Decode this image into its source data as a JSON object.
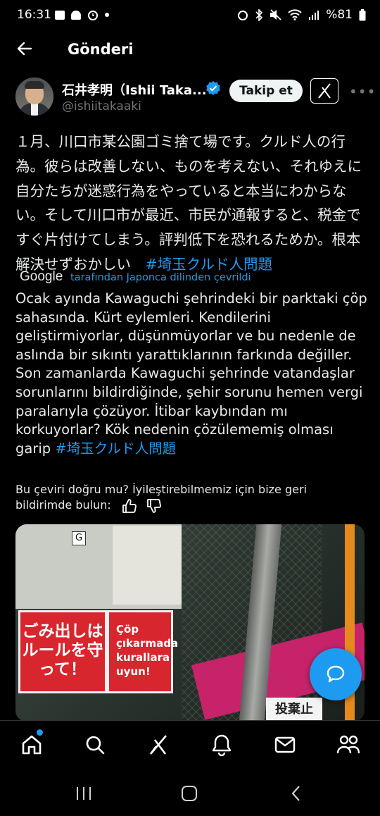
{
  "status_bar": {
    "time": "16:31",
    "battery": "%81",
    "icons": [
      "gallery-icon",
      "messages-icon",
      "alarm-icon",
      "dot-icon",
      "alarm-icon",
      "bluetooth-icon",
      "mute-icon",
      "wifi-icon",
      "signal-icon",
      "battery-icon"
    ]
  },
  "header": {
    "title": "Gönderi",
    "back_icon": "arrow-left-icon"
  },
  "post": {
    "author_name": "石井孝明（Ishii Taka...",
    "author_handle": "@ishiitakaaki",
    "verified_icon": "verified-badge-icon",
    "follow_label": "Takip et",
    "grok_icon": "grok-icon",
    "more_icon": "more-horizontal-icon",
    "original_text": "１月、川口市某公園ゴミ捨て場です。クルド人の行為。彼らは改善しない、ものを考えない、それゆえに自分たちが迷惑行為をやっていると本当にわからない。そして川口市が最近、市民が通報すると、税金ですぐ片付けてしまう。評判低下を恐れるためか。根本解決せずおかしい　",
    "original_hashtag": "#埼玉クルド人問題",
    "translation_provider": "Google",
    "translation_via": "tarafından Japonca dilinden çevrildi",
    "translated_text": "Ocak ayında Kawaguchi şehrindeki bir parktaki çöp sahasında. Kürt eylemleri. Kendilerini geliştirmiyorlar, düşünmüyorlar ve bu nedenle de aslında bir sıkıntı yarattıklarının farkında değiller. Son zamanlarda Kawaguchi şehrinde vatandaşlar sorunlarını bildirdiğinde, şehir sorunu hemen vergi paralarıyla çözüyor. İtibar kaybından mı korkuyorlar? Kök nedenin çözülememiş olması garip ",
    "translated_hashtag": "#埼玉クルド人問題",
    "feedback_text": "Bu çeviri doğru mu? İyileştirebilmemiz için bize geri bildirimde bulun:",
    "thumbs_up_icon": "thumbs-up-icon",
    "thumbs_down_icon": "thumbs-down-icon",
    "media": {
      "sign1_text": "ごみ出しはルールを守って！",
      "sign2_text": "Çöp çıkarmada kurallara uyun!",
      "sign_g": "G",
      "sign_bottom": "投棄止"
    }
  },
  "fab_icon": "chat-bubble-icon",
  "bottom_nav": [
    {
      "name": "home-icon",
      "badge": true
    },
    {
      "name": "search-icon"
    },
    {
      "name": "grok-icon"
    },
    {
      "name": "notifications-icon"
    },
    {
      "name": "messages-icon"
    },
    {
      "name": "communities-icon"
    }
  ],
  "system_nav": [
    "recents-icon",
    "home-button-icon",
    "back-icon"
  ],
  "colors": {
    "background": "#000000",
    "text": "#e7e9ea",
    "secondary": "#71767b",
    "accent": "#1d9bf0"
  }
}
